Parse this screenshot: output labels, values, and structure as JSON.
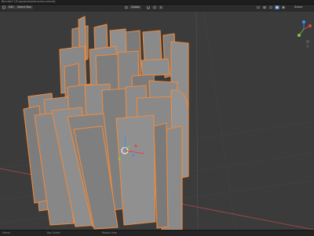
{
  "window": {
    "title": "Blender* [D:\\projects\\extrusions.blend]"
  },
  "header": {
    "mode_label": "Edit",
    "select_label": "Select Box",
    "orientation_label": "Global",
    "scene_label": "Scene"
  },
  "icons": {
    "editor_type": "cube-icon",
    "snap": "magnet-icon",
    "proportional": "circle-icon",
    "overlays": "overlay-icon",
    "shading": "sphere-icon",
    "gizmo": "navigation-gizmo-icon",
    "cursor": "3d-cursor-icon"
  },
  "colors": {
    "viewport_bg": "#3b3b3b",
    "mesh_face": "#8a8a8a",
    "mesh_edge": "#f08a3c",
    "axis_x": "#e04646",
    "axis_y": "#7ac943",
    "axis_z": "#4a8cf0"
  },
  "statusbar": {
    "left": "Select",
    "middle": "Box Select",
    "right": "Rotate View"
  }
}
